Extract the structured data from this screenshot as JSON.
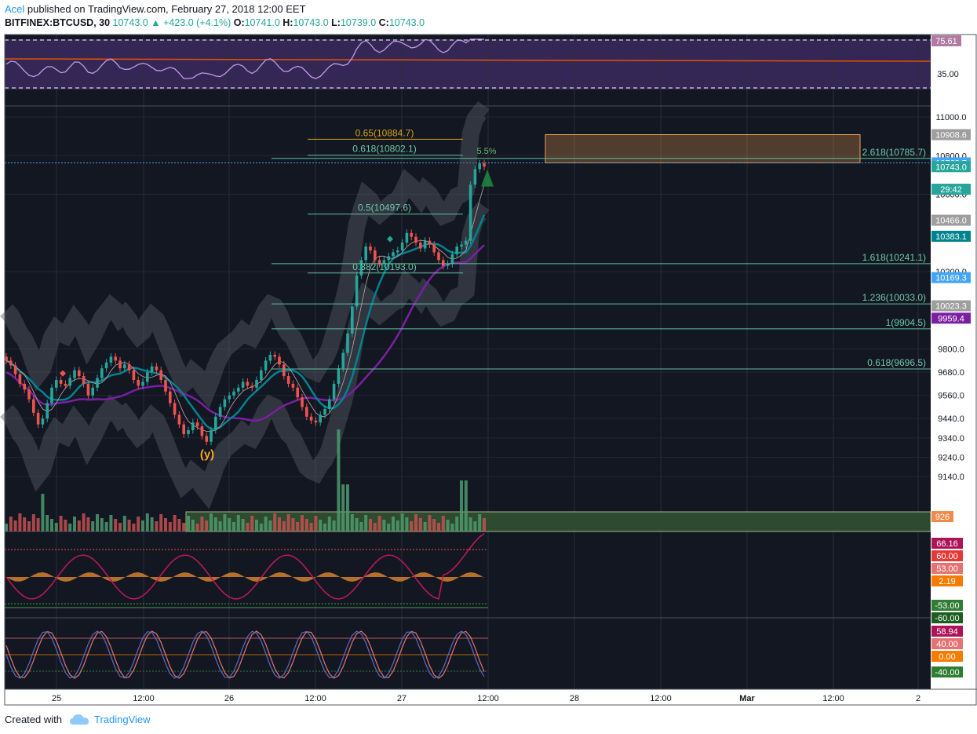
{
  "header": {
    "author": "Acel",
    "published_text": "published on TradingView.com, February 27, 2018 12:00 EET",
    "symbol": "BITFINEX:BTCUSD, 30",
    "last": "10743.0",
    "change": "+423.0 (+4.1%)",
    "o_label": "O:",
    "o_value": "10741.0",
    "h_label": "H:",
    "h_value": "10743.0",
    "l_label": "L:",
    "l_value": "10739.0",
    "c_label": "C:",
    "c_value": "10743.0"
  },
  "footer": {
    "created_with": "Created with",
    "brand": "TradingView"
  },
  "colors": {
    "background": "#131722",
    "up": "#26a69a",
    "down": "#ef5350",
    "fib_line": "#5fbf9f",
    "fib_text": "#6fc9a9",
    "fib_orange": "#d4a017",
    "purple": "#7b1fa2",
    "teal": "#00838f",
    "rsi_line": "#c39ae8",
    "volume_zone": "#2e4a30",
    "target_box": "#f0a050"
  },
  "chart_data": {
    "type": "candlestick",
    "symbol": "BITFINEX:BTCUSD",
    "timeframe": "30",
    "price_axis_ticks": [
      "11000.0",
      "10800.0",
      "10600.0",
      "10200.0",
      "9800.0",
      "9680.0",
      "9560.0",
      "9440.0",
      "9340.0",
      "9240.0",
      "9140.0"
    ],
    "time_axis_ticks": [
      "25",
      "12:00",
      "26",
      "12:00",
      "27",
      "12:00",
      "28",
      "12:00",
      "Mar",
      "12:00",
      "2"
    ],
    "price_labels": [
      {
        "value": "10908.6",
        "price": 10908.6,
        "bg": "#9e9e9e"
      },
      {
        "value": "10762.7",
        "price": 10762.7,
        "bg": "#42a5f5"
      },
      {
        "value": "10743.0",
        "price": 10743.0,
        "bg": "#26a69a"
      },
      {
        "value": "29:42",
        "price": 10700,
        "bg": "#26a69a"
      },
      {
        "value": "10466.0",
        "price": 10466.0,
        "bg": "#9e9e9e"
      },
      {
        "value": "10383.1",
        "price": 10383.1,
        "bg": "#00838f"
      },
      {
        "value": "10169.3",
        "price": 10169.3,
        "bg": "#42a5f5"
      },
      {
        "value": "10023.3",
        "price": 10023.3,
        "bg": "#9e9e9e"
      },
      {
        "value": "9959.4",
        "price": 9959.4,
        "bg": "#7b1fa2"
      }
    ],
    "fib_levels": [
      {
        "label": "0.65(10884.7)",
        "price": 10884.7,
        "color": "orange",
        "start": "retrace"
      },
      {
        "label": "0.618(10802.1)",
        "price": 10802.1,
        "color": "green",
        "start": "retrace"
      },
      {
        "label": "0.5(10497.6)",
        "price": 10497.6,
        "color": "green",
        "start": "retrace"
      },
      {
        "label": "0.382(10193.0)",
        "price": 10193.0,
        "color": "green",
        "start": "retrace"
      },
      {
        "label": "2.618(10785.7)",
        "price": 10785.7,
        "color": "green",
        "start": "ext"
      },
      {
        "label": "1.618(10241.1)",
        "price": 10241.1,
        "color": "green",
        "start": "ext"
      },
      {
        "label": "1.236(10033.0)",
        "price": 10033.0,
        "color": "green",
        "start": "ext"
      },
      {
        "label": "1(9904.5)",
        "price": 9904.5,
        "color": "green",
        "start": "ext"
      },
      {
        "label": "0.618(9696.5)",
        "price": 9696.5,
        "color": "green",
        "start": "ext"
      }
    ],
    "target_zone": {
      "top": 10908.6,
      "bottom": 10762.7
    },
    "annotations": {
      "wave_label": "(y)",
      "pct_label": "5.5%"
    },
    "volume": {
      "label": "926"
    },
    "rsi": {
      "labels": [
        "75.61",
        "35.00"
      ]
    },
    "osc1": {
      "labels": [
        {
          "v": "66.16",
          "bg": "#ad1457"
        },
        {
          "v": "60.00",
          "bg": "#e53935"
        },
        {
          "v": "53.00",
          "bg": "#e57373"
        },
        {
          "v": "2.19",
          "bg": "#f57c00"
        },
        {
          "v": "-53.00",
          "bg": "#2e7d32"
        },
        {
          "v": "-60.00",
          "bg": "#1b5e20"
        }
      ]
    },
    "osc2": {
      "labels": [
        {
          "v": "58.94",
          "bg": "#ad1457"
        },
        {
          "v": "40.00",
          "bg": "#e57373"
        },
        {
          "v": "0.00",
          "bg": "#f57c00"
        },
        {
          "v": "-40.00",
          "bg": "#2e7d32"
        }
      ]
    },
    "closes": [
      9740,
      9715,
      9670,
      9620,
      9590,
      9540,
      9470,
      9410,
      9440,
      9520,
      9600,
      9640,
      9620,
      9610,
      9650,
      9690,
      9660,
      9620,
      9560,
      9600,
      9650,
      9700,
      9730,
      9760,
      9740,
      9700,
      9720,
      9690,
      9640,
      9610,
      9630,
      9680,
      9710,
      9690,
      9640,
      9580,
      9520,
      9460,
      9410,
      9360,
      9380,
      9420,
      9400,
      9350,
      9320,
      9380,
      9450,
      9500,
      9540,
      9560,
      9580,
      9600,
      9630,
      9610,
      9600,
      9640,
      9690,
      9740,
      9770,
      9760,
      9720,
      9660,
      9620,
      9600,
      9550,
      9500,
      9450,
      9430,
      9420,
      9460,
      9490,
      9540,
      9620,
      9700,
      9780,
      9880,
      10020,
      10180,
      10260,
      10330,
      10310,
      10260,
      10240,
      10260,
      10280,
      10300,
      10310,
      10350,
      10400,
      10380,
      10350,
      10320,
      10360,
      10340,
      10300,
      10260,
      10230,
      10240,
      10290,
      10330,
      10340,
      10360,
      10650,
      10730,
      10760,
      10743
    ]
  }
}
